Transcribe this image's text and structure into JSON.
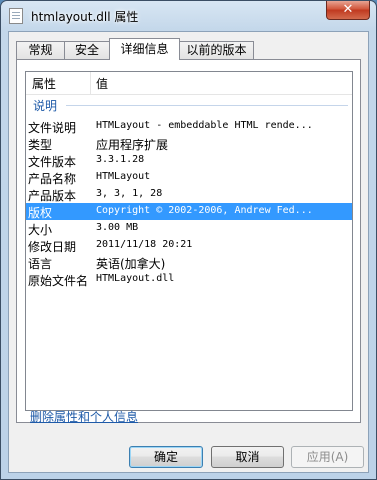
{
  "window": {
    "title": "htmlayout.dll 属性",
    "close_glyph": "✕"
  },
  "tabs": [
    {
      "label": "常规"
    },
    {
      "label": "安全"
    },
    {
      "label": "详细信息"
    },
    {
      "label": "以前的版本"
    }
  ],
  "details": {
    "col_property": "属性",
    "col_value": "值",
    "group_label": "说明",
    "rows": [
      {
        "key": "文件说明",
        "value": "HTMLayout - embeddable HTML rende..."
      },
      {
        "key": "类型",
        "value": "应用程序扩展"
      },
      {
        "key": "文件版本",
        "value": "3.3.1.28"
      },
      {
        "key": "产品名称",
        "value": "HTMLayout"
      },
      {
        "key": "产品版本",
        "value": "3, 3, 1, 28"
      },
      {
        "key": "版权",
        "value": "Copyright © 2002-2006, Andrew Fed..."
      },
      {
        "key": "大小",
        "value": "3.00 MB"
      },
      {
        "key": "修改日期",
        "value": "2011/11/18 20:21"
      },
      {
        "key": "语言",
        "value": "英语(加拿大)"
      },
      {
        "key": "原始文件名",
        "value": "HTMLayout.dll"
      }
    ]
  },
  "links": {
    "remove_properties": "删除属性和个人信息"
  },
  "buttons": {
    "ok": "确定",
    "cancel": "取消",
    "apply": "应用(A)"
  }
}
